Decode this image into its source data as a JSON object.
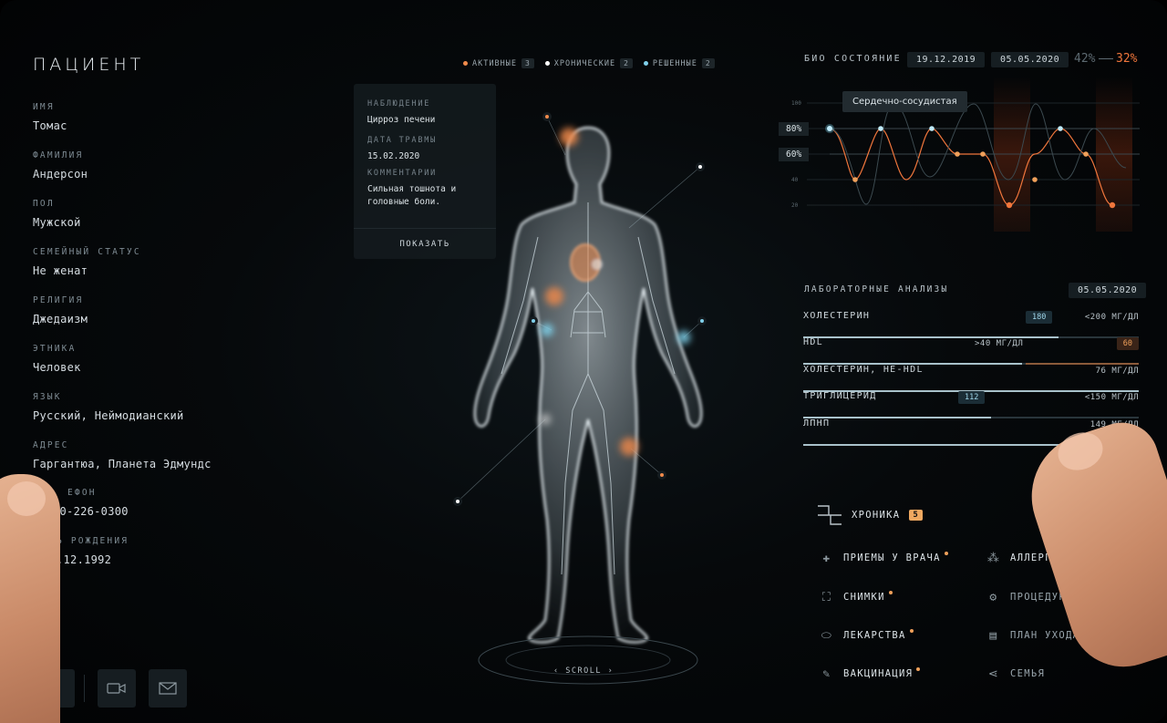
{
  "patient": {
    "title": "ПАЦИЕНТ",
    "fields": [
      {
        "label": "ИМЯ",
        "value": "Томас"
      },
      {
        "label": "ФАМИЛИЯ",
        "value": "Андерсон"
      },
      {
        "label": "ПОЛ",
        "value": "Мужской"
      },
      {
        "label": "СЕМЕЙНЫЙ СТАТУС",
        "value": "Не женат"
      },
      {
        "label": "РЕЛИГИЯ",
        "value": "Джедаизм"
      },
      {
        "label": "ЭТНИКА",
        "value": "Человек"
      },
      {
        "label": "ЯЗЫК",
        "value": "Русский, Неймодианский"
      },
      {
        "label": "АДРЕС",
        "value": "Гаргантюа, Планета Эдмундс"
      },
      {
        "label": "ЕФОН",
        "value": "00-226-0300"
      },
      {
        "label": "Ь РОЖДЕНИЯ",
        "value": ".12.1992"
      }
    ]
  },
  "legend": [
    {
      "label": "АКТИВНЫЕ",
      "count": "3",
      "color": "#f08a4b"
    },
    {
      "label": "ХРОНИЧЕСКИЕ",
      "count": "2",
      "color": "#ffffff"
    },
    {
      "label": "РЕШЕННЫЕ",
      "count": "2",
      "color": "#7fd0ea"
    }
  ],
  "observation": {
    "obs_label": "НАБЛЮДЕНИЕ",
    "obs_value": "Цирроз печени",
    "date_label": "ДАТА ТРАВМЫ",
    "date_value": "15.02.2020",
    "comment_label": "КОММЕНТАРИИ",
    "comment_value": "Сильная тошнота и головные боли.",
    "show_button": "ПОКАЗАТЬ"
  },
  "scroll_label": "SCROLL",
  "bio": {
    "title": "БИО СОСТОЯНИЕ",
    "date1": "19.12.2019",
    "date2": "05.05.2020",
    "pct_old": "42%",
    "pct_new": "32%",
    "tooltip": "Сердечно-сосудистая",
    "marker_80": "80%",
    "marker_60": "60%",
    "ticks": [
      "100",
      "80",
      "60",
      "40",
      "20"
    ]
  },
  "labs": {
    "title": "ЛАБОРАТОРНЫЕ АНАЛИЗЫ",
    "date": "05.05.2020",
    "rows": [
      {
        "name": "ХОЛЕСТЕРИН",
        "value": "180",
        "norm": "<200 МГ/ДЛ"
      },
      {
        "name": "HDL",
        "value": "60",
        "norm": ">40 МГ/ДЛ"
      },
      {
        "name": "ХОЛЕСТЕРИН, НЕ-HDL",
        "value": "",
        "norm": "76 МГ/ДЛ"
      },
      {
        "name": "ТРИГЛИЦЕРИД",
        "value": "112",
        "norm": "<150 МГ/ДЛ"
      },
      {
        "name": "ЛПНП",
        "value": "",
        "norm": "149 МГ/ДЛ"
      }
    ]
  },
  "menu": {
    "chronicle": "ХРОНИКА",
    "chronicle_count": "5",
    "appointments": "ПРИЕМЫ У ВРАЧА",
    "allergy": "АЛЛЕРГИЯ",
    "scans": "СНИМКИ",
    "procedures": "ПРОЦЕДУРЫ",
    "medicine": "ЛЕКАРСТВА",
    "care_plan": "ПЛАН УХОДА",
    "vaccination": "ВАКЦИНАЦИЯ",
    "family": "СЕМЬЯ"
  },
  "colors": {
    "accent_orange": "#f08a4b",
    "accent_blue": "#7fd0ea"
  }
}
